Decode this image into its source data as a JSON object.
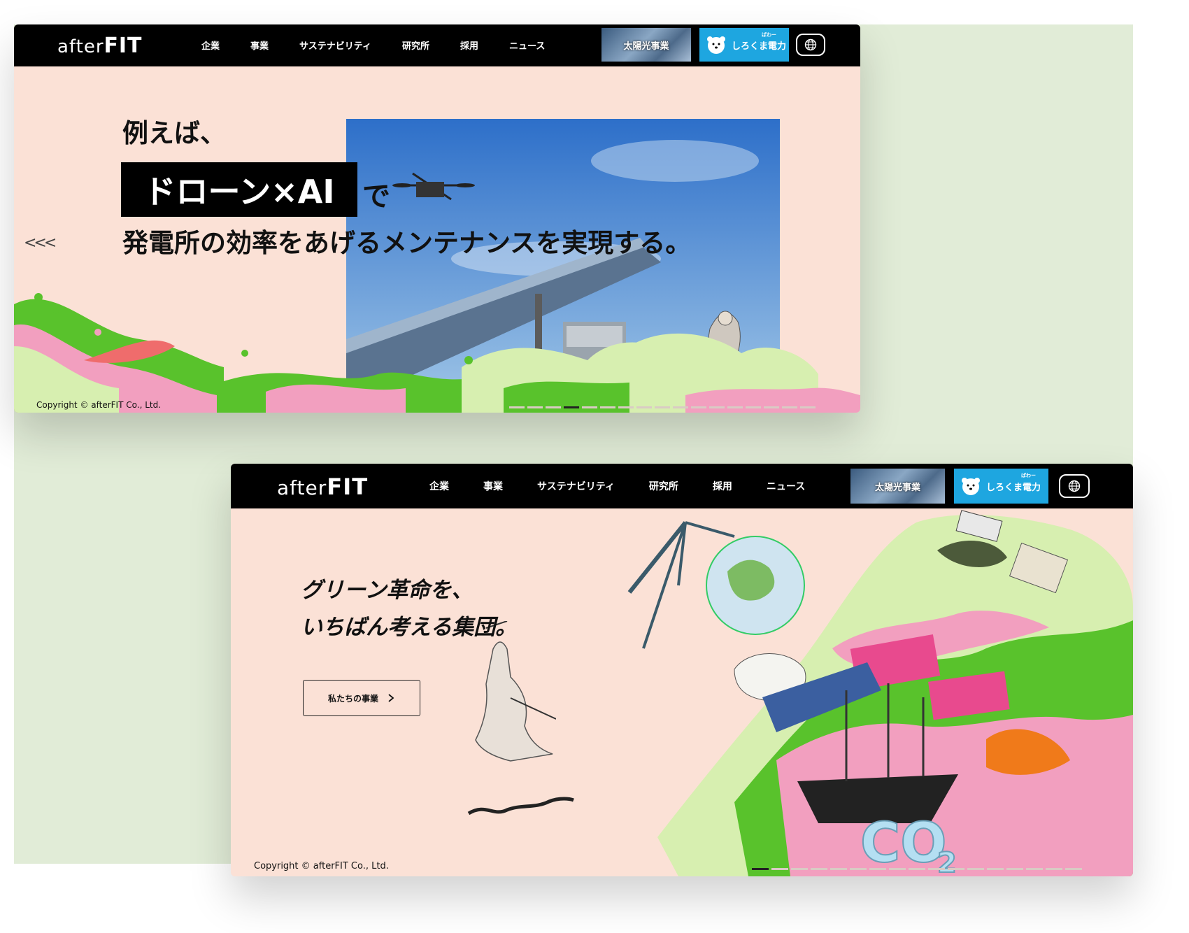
{
  "colors": {
    "page_bg": "#ffffff",
    "backdrop": "#e1ecd7",
    "hero_bg": "#fbe1d6",
    "nav_bg": "#000000",
    "power_btn": "#1ea6e0",
    "splash_green": "#59c22c",
    "splash_pink": "#f29fbf",
    "splash_red": "#ef6c6c",
    "splash_pale": "#d7efb0"
  },
  "top": {
    "logo": {
      "part1": "after",
      "part2": "FIT"
    },
    "menu": [
      "企業",
      "事業",
      "サステナビリティ",
      "研究所",
      "採用",
      "ニュース"
    ],
    "solar_button": "太陽光事業",
    "power_button": "しろくま電力",
    "power_ruby": "ぱわー",
    "globe_icon": "globe-icon",
    "hero": {
      "line1": "例えば、",
      "highlight": "ドローン×AI",
      "line2_suffix": "で",
      "line3": "発電所の効率をあげるメンテナンスを実現する。"
    },
    "prev_arrows": "<<<",
    "copyright": "Copyright © afterFIT Co., Ltd."
  },
  "bottom": {
    "logo": {
      "part1": "after",
      "part2": "FIT"
    },
    "menu": [
      "企業",
      "事業",
      "サステナビリティ",
      "研究所",
      "採用",
      "ニュース"
    ],
    "solar_button": "太陽光事業",
    "power_button": "しろくま電力",
    "power_ruby": "ぱわー",
    "globe_icon": "globe-icon",
    "hero": {
      "line1": "グリーン革命を、",
      "line2": "いちばん考える集団。",
      "cta": "私たちの事業",
      "co2": "CO"
    },
    "copyright": "Copyright © afterFIT Co., Ltd."
  }
}
